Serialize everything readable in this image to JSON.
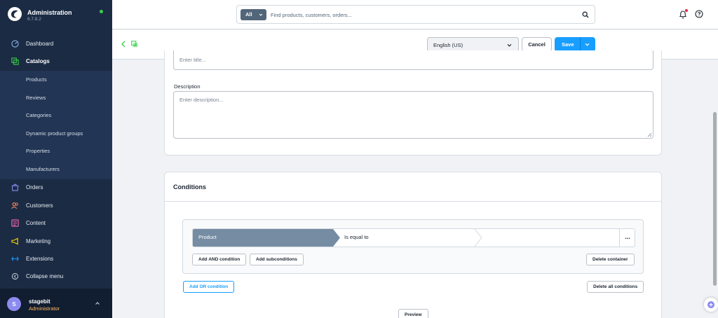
{
  "sidebar": {
    "app_title": "Administration",
    "version": "6.7.8.2",
    "items": [
      {
        "label": "Dashboard"
      },
      {
        "label": "Catalogs"
      },
      {
        "label": "Products"
      },
      {
        "label": "Reviews"
      },
      {
        "label": "Categories"
      },
      {
        "label": "Dynamic product groups"
      },
      {
        "label": "Properties"
      },
      {
        "label": "Manufacturers"
      },
      {
        "label": "Orders"
      },
      {
        "label": "Customers"
      },
      {
        "label": "Content"
      },
      {
        "label": "Marketing"
      },
      {
        "label": "Extensions"
      },
      {
        "label": "Collapse menu"
      }
    ],
    "user": {
      "initial": "S",
      "name": "stagebit",
      "role": "Administrator"
    }
  },
  "search": {
    "scope": "All",
    "placeholder": "Find products, customers, orders..."
  },
  "actionbar": {
    "language": "English (US)",
    "cancel_label": "Cancel",
    "save_label": "Save"
  },
  "form": {
    "title_placeholder": "Enter title...",
    "description_label": "Description",
    "description_placeholder": "Enter description..."
  },
  "conditions": {
    "heading": "Conditions",
    "field": "Product",
    "operator": "Is equal to",
    "more_label": "...",
    "add_and_label": "Add AND condition",
    "add_sub_label": "Add subconditions",
    "delete_container_label": "Delete container",
    "add_or_label": "Add OR condition",
    "delete_all_label": "Delete all conditions",
    "preview_label": "Preview"
  },
  "colors": {
    "sidebar": "#1b2b44",
    "accent": "#189eff",
    "condition_field": "#758ca3"
  }
}
